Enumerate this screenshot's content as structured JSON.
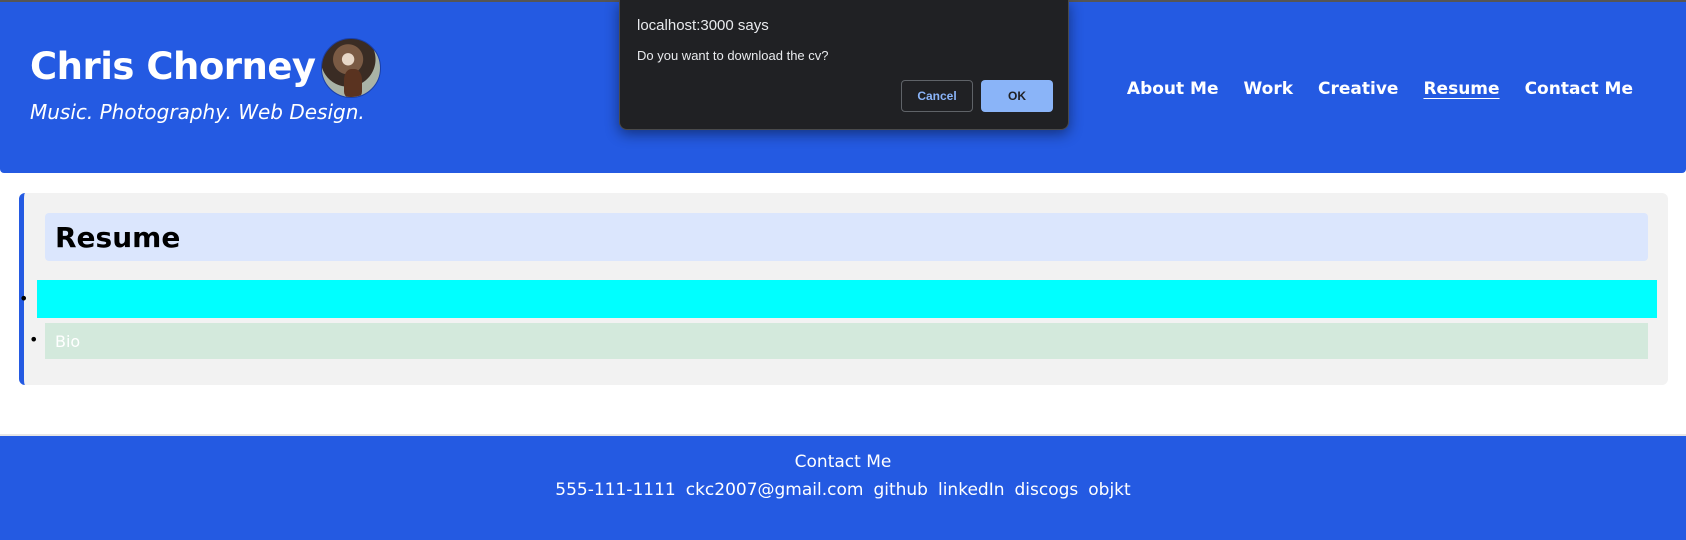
{
  "header": {
    "title": "Chris Chorney",
    "tagline": "Music. Photography. Web Design.",
    "nav": [
      {
        "label": "About Me"
      },
      {
        "label": "Work"
      },
      {
        "label": "Creative"
      },
      {
        "label": "Resume",
        "active": true
      },
      {
        "label": "Contact Me"
      }
    ]
  },
  "main": {
    "heading": "Resume",
    "items": [
      {
        "label": ""
      },
      {
        "label": "Bio"
      }
    ]
  },
  "footer": {
    "title": "Contact Me",
    "links": [
      "555-111-1111",
      "ckc2007@gmail.com",
      "github",
      "linkedIn",
      "discogs",
      "objkt"
    ]
  },
  "dialog": {
    "title": "localhost:3000 says",
    "message": "Do you want to download the cv?",
    "cancel_label": "Cancel",
    "ok_label": "OK"
  },
  "colors": {
    "brand_blue": "#245ae2",
    "cyan_item": "#00ffff",
    "dialog_accent": "#8ab4f8"
  }
}
